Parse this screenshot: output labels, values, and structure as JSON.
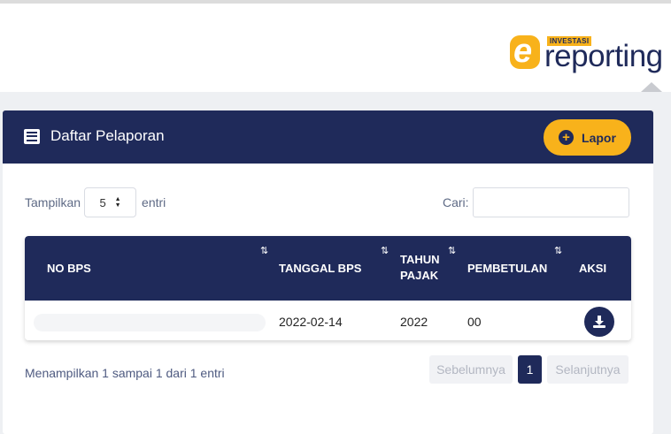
{
  "brand": {
    "logo_letter": "e",
    "logo_badge": "INVESTASI",
    "logo_text": "reporting",
    "colors": {
      "primary": "#1f2a5a",
      "accent": "#f8b21b"
    }
  },
  "card": {
    "title": "Daftar Pelaporan",
    "title_icon": "list-icon",
    "lapor_label": "Lapor",
    "lapor_icon": "plus-circle-icon"
  },
  "controls": {
    "show_label": "Tampilkan",
    "page_size": "5",
    "entries_label": "entri",
    "search_label": "Cari:",
    "search_value": ""
  },
  "table": {
    "headers": {
      "no_bps": "NO BPS",
      "tanggal_bps": "TANGGAL BPS",
      "tahun_pajak_1": "TAHUN",
      "tahun_pajak_2": "PAJAK",
      "pembetulan": "PEMBETULAN",
      "aksi": "AKSI"
    },
    "sort_icon": "sort-icon",
    "rows": [
      {
        "no_bps": "",
        "tanggal_bps": "2022-02-14",
        "tahun_pajak": "2022",
        "pembetulan": "00",
        "action_icon": "download-icon"
      }
    ]
  },
  "footer": {
    "info": "Menampilkan 1 sampai 1 dari 1 entri",
    "prev": "Sebelumnya",
    "current_page": "1",
    "next": "Selanjutnya"
  }
}
